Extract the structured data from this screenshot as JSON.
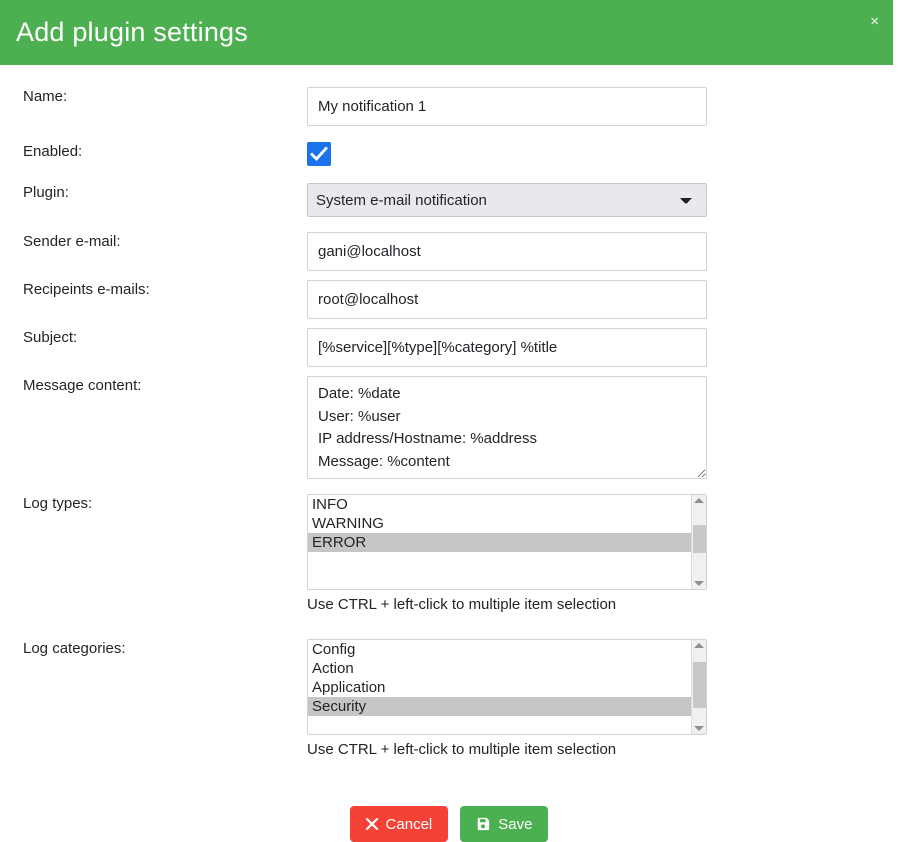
{
  "dialog": {
    "title": "Add plugin settings",
    "close_label": "×",
    "accent_color": "#4CAF50",
    "checkbox_color": "#1a73e8",
    "cancel_color": "#f44336",
    "save_color": "#4CAF50"
  },
  "fields": {
    "name": {
      "label": "Name:",
      "value": "My notification 1",
      "placeholder": ""
    },
    "enabled": {
      "label": "Enabled:",
      "checked": true
    },
    "plugin": {
      "label": "Plugin:",
      "value": "System e-mail notification",
      "options": [
        "System e-mail notification"
      ]
    },
    "sender_email": {
      "label": "Sender e-mail:",
      "value": "gani@localhost",
      "placeholder": ""
    },
    "recipients_emails": {
      "label": "Recipeints e-mails:",
      "value": "root@localhost",
      "placeholder": ""
    },
    "subject": {
      "label": "Subject:",
      "value": "[%service][%type][%category] %title",
      "placeholder": ""
    },
    "message_content": {
      "label": "Message content:",
      "value": "Date: %date\nUser: %user\nIP address/Hostname: %address\nMessage: %content",
      "placeholder": ""
    },
    "log_types": {
      "label": "Log types:",
      "items": [
        "INFO",
        "WARNING",
        "ERROR"
      ],
      "selected": [
        "ERROR"
      ],
      "help": "Use CTRL + left-click to multiple item selection"
    },
    "log_categories": {
      "label": "Log categories:",
      "items": [
        "Config",
        "Action",
        "Application",
        "Security"
      ],
      "selected": [
        "Security"
      ],
      "help": "Use CTRL + left-click to multiple item selection"
    }
  },
  "footer": {
    "cancel_label": "Cancel",
    "save_label": "Save",
    "cancel_icon": "close-icon",
    "save_icon": "floppy-disk-icon"
  }
}
